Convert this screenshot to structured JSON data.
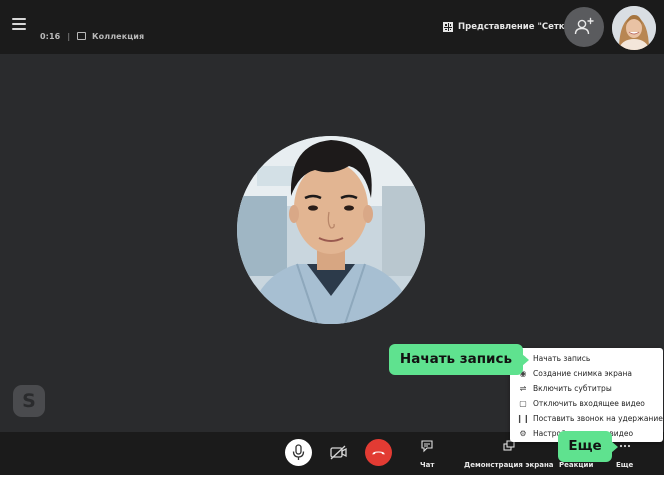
{
  "header": {
    "timer": "0:16",
    "collection_label": "Коллекция",
    "view_selector_label": "Представление \"Сетка\""
  },
  "toolbar": {
    "chat_label": "Чат",
    "screen_share_label": "Демонстрация экрана",
    "reactions_label": "Реакции",
    "more_label": "Еще"
  },
  "more_menu": {
    "items": [
      {
        "label": "Начать запись",
        "icon": "record-icon"
      },
      {
        "label": "Создание снимка экрана",
        "icon": "camera-icon"
      },
      {
        "label": "Включить субтитры",
        "icon": "subtitles-icon"
      },
      {
        "label": "Отключить входящее видео",
        "icon": "video-off-icon"
      },
      {
        "label": "Поставить звонок на удержание",
        "icon": "pause-icon"
      },
      {
        "label": "Настройки звука и видео",
        "icon": "gear-icon"
      }
    ]
  },
  "callouts": {
    "record": "Начать запись",
    "more": "Еще"
  },
  "badge": {
    "skype_letter": "S"
  },
  "colors": {
    "bar_bg": "#1b1b1b",
    "stage_bg": "#2a2b2d",
    "hangup": "#e23b33",
    "callout": "#5fe28f"
  }
}
